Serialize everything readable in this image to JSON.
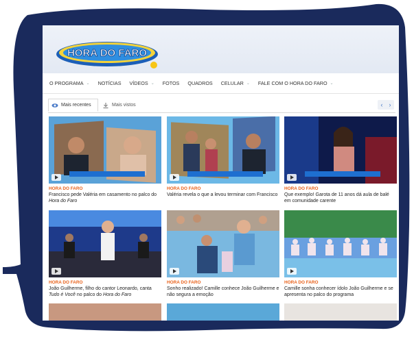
{
  "logo": {
    "text": "HORA DO FARO"
  },
  "nav": [
    {
      "label": "O PROGRAMA",
      "dropdown": true
    },
    {
      "label": "NOTÍCIAS",
      "dropdown": false
    },
    {
      "label": "VÍDEOS",
      "dropdown": true
    },
    {
      "label": "FOTOS",
      "dropdown": false
    },
    {
      "label": "QUADROS",
      "dropdown": false
    },
    {
      "label": "CELULAR",
      "dropdown": true
    },
    {
      "label": "FALE COM O HORA DO FARO",
      "dropdown": true
    }
  ],
  "tabs": {
    "recent": "Mais recentes",
    "viewed": "Mais vistos"
  },
  "arrows": {
    "prev": "‹",
    "next": "›"
  },
  "cards": [
    {
      "category": "HORA DO FARO",
      "title": "Francisco pede Valéria em casamento no palco do",
      "title_em": "Hora do Faro",
      "title_after": ""
    },
    {
      "category": "HORA DO FARO",
      "title": "Valéria revela o que a levou terminar com Francisco",
      "title_em": "",
      "title_after": ""
    },
    {
      "category": "HORA DO FARO",
      "title": "Que exemplo! Garota de 11 anos dá aula de balé em comunidade carente",
      "title_em": "",
      "title_after": ""
    },
    {
      "category": "HORA DO FARO",
      "title": "João Guilherme, filho do cantor Leonardo, canta",
      "title_em": "Tudo é Você",
      "title_after": " no palco do ",
      "title_em2": "Hora do Faro"
    },
    {
      "category": "HORA DO FARO",
      "title": "Sonho realizado! Camille conhece João Guilherme e não segura a emoção",
      "title_em": "",
      "title_after": ""
    },
    {
      "category": "HORA DO FARO",
      "title": "Camille sonha conhecer ídolo João Guilherme e se apresenta no palco do programa",
      "title_em": "",
      "title_after": ""
    }
  ],
  "colors": {
    "frame": "#1a2a5c",
    "accent": "#e8611a",
    "link": "#4a7bc8"
  }
}
